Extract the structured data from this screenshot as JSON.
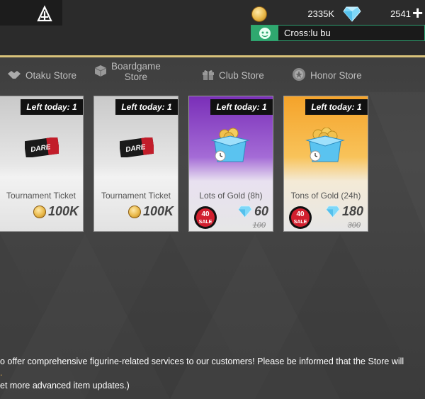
{
  "header": {
    "coins": "2335K",
    "gems": "2541",
    "plus_symbol": "+",
    "club_name": "Cross:lu bu"
  },
  "tabs": [
    {
      "label": "Otaku Store",
      "icon": "handshake-icon"
    },
    {
      "label_line1": "Boardgame",
      "label_line2": "Store",
      "icon": "cube-icon"
    },
    {
      "label": "Club Store",
      "icon": "gift-icon"
    },
    {
      "label": "Honor Store",
      "icon": "medal-icon"
    }
  ],
  "cards": [
    {
      "left_today": "Left today: 1",
      "name": "Tournament Ticket",
      "price": "100K",
      "currency": "coin-icon"
    },
    {
      "left_today": "Left today: 1",
      "name": "Tournament Ticket",
      "price": "100K",
      "currency": "coin-icon"
    },
    {
      "left_today": "Left today: 1",
      "name": "Lots of Gold (8h)",
      "price": "60",
      "old_price": "100",
      "currency": "gem-icon",
      "sale": "40% OFF SALE"
    },
    {
      "left_today": "Left today: 1",
      "name": "Tons of Gold (24h)",
      "price": "180",
      "old_price": "300",
      "currency": "gem-icon",
      "sale": "40% OFF SALE"
    }
  ],
  "ticket_text": "DARE",
  "info": {
    "line1": "o offer comprehensive figurine-related services to our customers! Please be informed that the Store will",
    "line2": ".",
    "line3": "et more advanced item updates.)"
  },
  "colors": {
    "accent_gold": "#d9c27a",
    "club_green": "#2fa86f",
    "purple_card": "#7a2fb8",
    "orange_card": "#f5a32a"
  }
}
